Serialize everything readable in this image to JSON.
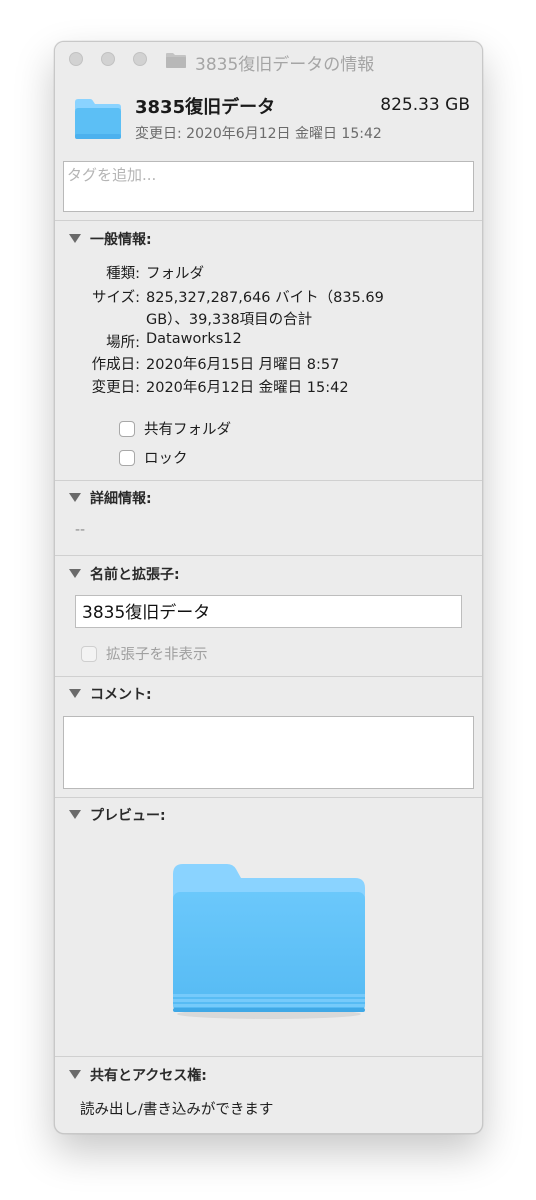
{
  "window": {
    "title": "3835復旧データの情報"
  },
  "header": {
    "name": "3835復旧データ",
    "size": "825.33 GB",
    "modified": "変更日: 2020年6月12日 金曜日 15:42"
  },
  "tags": {
    "placeholder": "タグを追加..."
  },
  "general": {
    "heading": "一般情報:",
    "rows": [
      {
        "label": "種類:",
        "value": "フォルダ"
      },
      {
        "label": "サイズ:",
        "value": "825,327,287,646 バイト（835.69",
        "value2": "GB）、39,338項目の合計"
      },
      {
        "label": "場所:",
        "value": "Dataworks12"
      },
      {
        "label": "作成日:",
        "value": "2020年6月15日 月曜日 8:57"
      },
      {
        "label": "変更日:",
        "value": "2020年6月12日 金曜日 15:42"
      }
    ],
    "shared_folder_label": "共有フォルダ",
    "lock_label": "ロック"
  },
  "details": {
    "heading": "詳細情報:",
    "value": "--"
  },
  "name_ext": {
    "heading": "名前と拡張子:",
    "value": "3835復旧データ",
    "hide_extension_label": "拡張子を非表示"
  },
  "comments": {
    "heading": "コメント:",
    "value": ""
  },
  "preview": {
    "heading": "プレビュー:"
  },
  "sharing": {
    "heading": "共有とアクセス権:",
    "permission": "読み出し/書き込みができます"
  },
  "icons": {
    "folder": "folder-icon",
    "disclosure": "disclosure-triangle-icon",
    "title_folder": "folder-icon"
  },
  "colors": {
    "folder_light": "#8ad3ff",
    "folder_main": "#5cbff5",
    "folder_dark": "#3aa7e8",
    "window_bg": "#ececec"
  }
}
